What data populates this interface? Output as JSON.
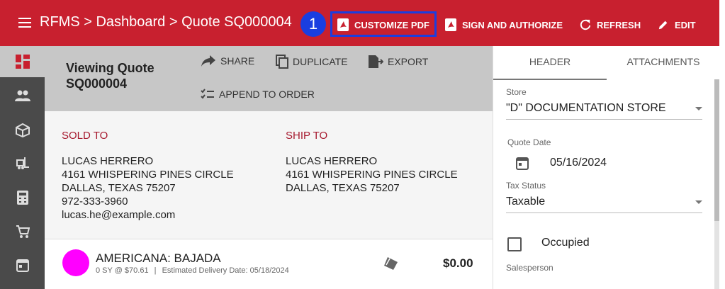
{
  "header": {
    "breadcrumb": "RFMS > Dashboard > Quote SQ000004",
    "step_badge": "1",
    "buttons": {
      "customize_pdf": "CUSTOMIZE PDF",
      "sign_authorize": "SIGN AND AUTHORIZE",
      "refresh": "REFRESH",
      "edit": "EDIT"
    }
  },
  "sidebar": {
    "items": [
      "dashboard-icon",
      "people-icon",
      "box-icon",
      "forklift-icon",
      "calculator-icon",
      "cart-icon",
      "calendar-icon"
    ]
  },
  "quote": {
    "title_line1": "Viewing Quote",
    "title_line2": "SQ000004",
    "actions": {
      "share": "SHARE",
      "duplicate": "DUPLICATE",
      "export": "EXPORT",
      "append": "APPEND TO ORDER"
    },
    "sold_to": {
      "heading": "SOLD TO",
      "name": "LUCAS HERRERO",
      "street": "4161 WHISPERING PINES CIRCLE",
      "city": "DALLAS, TEXAS 75207",
      "phone": "972-333-3960",
      "email": "lucas.he@example.com"
    },
    "ship_to": {
      "heading": "SHIP TO",
      "name": "LUCAS HERRERO",
      "street": "4161 WHISPERING PINES CIRCLE",
      "city": "DALLAS, TEXAS 75207"
    },
    "line_item": {
      "title": "AMERICANA: BAJADA",
      "qty_price": "0 SY @ $70.61",
      "separator": "|",
      "delivery": "Estimated Delivery Date: 05/18/2024",
      "price": "$0.00",
      "color": "#ff00ff"
    }
  },
  "panel": {
    "tabs": {
      "header": "HEADER",
      "attachments": "ATTACHMENTS"
    },
    "store_label": "Store",
    "store_value": "\"D\" DOCUMENTATION STORE",
    "quote_date_label": "Quote Date",
    "quote_date_value": "05/16/2024",
    "tax_status_label": "Tax Status",
    "tax_status_value": "Taxable",
    "occupied_label": "Occupied",
    "salesperson_label": "Salesperson"
  },
  "colors": {
    "brand": "#c8202f",
    "highlight": "#1a3ee0",
    "accent_text": "#a6192e"
  }
}
